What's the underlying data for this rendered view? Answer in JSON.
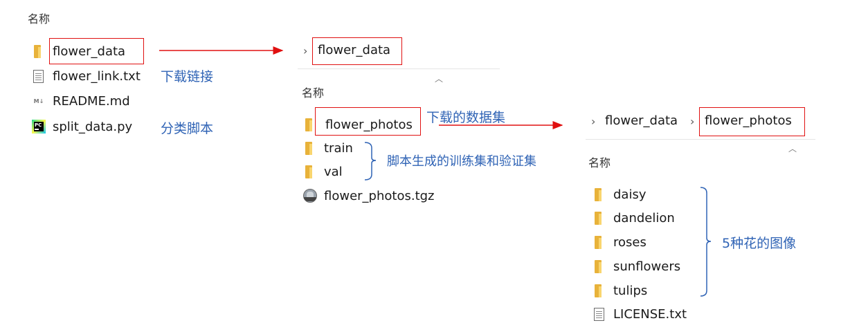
{
  "panel1": {
    "header": "名称",
    "items": [
      {
        "name": "flower_data",
        "icon": "folder-icon"
      },
      {
        "name": "flower_link.txt",
        "icon": "text-file-icon"
      },
      {
        "name": "README.md",
        "icon": "markdown-file-icon"
      },
      {
        "name": "split_data.py",
        "icon": "pycharm-file-icon"
      }
    ],
    "annotations": {
      "link": "下载链接",
      "script": "分类脚本"
    }
  },
  "panel2": {
    "breadcrumb": [
      "flower_data"
    ],
    "header": "名称",
    "items": [
      {
        "name": "flower_photos",
        "icon": "folder-icon"
      },
      {
        "name": "train",
        "icon": "folder-icon"
      },
      {
        "name": "val",
        "icon": "folder-icon"
      },
      {
        "name": "flower_photos.tgz",
        "icon": "archive-icon"
      }
    ],
    "annotations": {
      "downloaded": "下载的数据集",
      "generated": "脚本生成的训练集和验证集"
    }
  },
  "panel3": {
    "breadcrumb": [
      "flower_data",
      "flower_photos"
    ],
    "header": "名称",
    "items": [
      {
        "name": "daisy",
        "icon": "folder-icon"
      },
      {
        "name": "dandelion",
        "icon": "folder-icon"
      },
      {
        "name": "roses",
        "icon": "folder-icon"
      },
      {
        "name": "sunflowers",
        "icon": "folder-icon"
      },
      {
        "name": "tulips",
        "icon": "folder-icon"
      },
      {
        "name": "LICENSE.txt",
        "icon": "text-file-icon"
      }
    ],
    "annotations": {
      "images": "5种花的图像"
    }
  },
  "colors": {
    "annotation": "#2f63b5",
    "highlight": "#e01010",
    "folder": "#e8b23a"
  }
}
